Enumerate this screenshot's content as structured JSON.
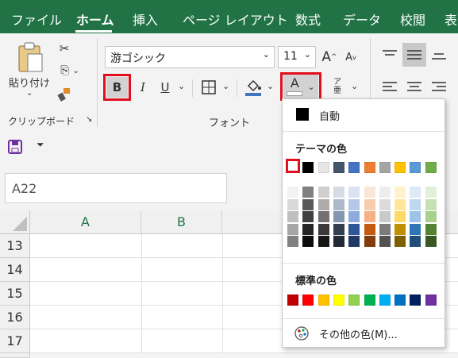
{
  "tabs": [
    {
      "label": "ファイル",
      "active": false
    },
    {
      "label": "ホーム",
      "active": true
    },
    {
      "label": "挿入",
      "active": false
    },
    {
      "label": "ページ レイアウト",
      "active": false
    },
    {
      "label": "数式",
      "active": false
    },
    {
      "label": "データ",
      "active": false
    },
    {
      "label": "校閲",
      "active": false
    },
    {
      "label": "表",
      "active": false
    }
  ],
  "clipboard": {
    "paste_label": "貼り付け",
    "group_label": "クリップボード"
  },
  "font": {
    "font_name": "游ゴシック",
    "font_size": "11",
    "group_label": "フォント",
    "bold_label": "B",
    "italic_label": "I",
    "underline_label": "U",
    "grow_label": "A",
    "shrink_label": "A",
    "font_color_label": "A",
    "phonetic_top": "ア",
    "phonetic_bottom": "亜"
  },
  "name_box": {
    "value": "A22"
  },
  "columns": [
    "A",
    "B"
  ],
  "rows": [
    "13",
    "14",
    "15",
    "16",
    "17"
  ],
  "color_menu": {
    "auto_label": "自動",
    "theme_title": "テーマの色",
    "standard_title": "標準の色",
    "more_colors_label": "その他の色(M)...",
    "theme_top": [
      "#ffffff",
      "#000000",
      "#e7e6e6",
      "#44546a",
      "#4472c4",
      "#ed7d31",
      "#a5a5a5",
      "#ffc000",
      "#5b9bd5",
      "#70ad47"
    ],
    "theme_shades": [
      [
        "#f2f2f2",
        "#808080",
        "#d0cece",
        "#d6dce5",
        "#dae3f3",
        "#fbe5d6",
        "#ededed",
        "#fff2cc",
        "#deebf7",
        "#e2f0d9"
      ],
      [
        "#d9d9d9",
        "#595959",
        "#aeabab",
        "#adb9ca",
        "#b4c7e7",
        "#f8cbad",
        "#dbdbdb",
        "#ffe699",
        "#bdd7ee",
        "#c5e0b4"
      ],
      [
        "#bfbfbf",
        "#404040",
        "#757171",
        "#8497b0",
        "#8faadc",
        "#f4b183",
        "#c9c9c9",
        "#ffd966",
        "#9dc3e6",
        "#a9d18e"
      ],
      [
        "#a6a6a6",
        "#262626",
        "#3a3838",
        "#333f50",
        "#2f5597",
        "#c55a11",
        "#7b7b7b",
        "#bf9000",
        "#2e75b6",
        "#548235"
      ],
      [
        "#808080",
        "#0d0d0d",
        "#171616",
        "#222a35",
        "#203864",
        "#843c0c",
        "#525252",
        "#7f6000",
        "#1f4e79",
        "#385723"
      ]
    ],
    "standard": [
      "#c00000",
      "#ff0000",
      "#ffc000",
      "#ffff00",
      "#92d050",
      "#00b050",
      "#00b0f0",
      "#0070c0",
      "#002060",
      "#7030a0"
    ]
  }
}
